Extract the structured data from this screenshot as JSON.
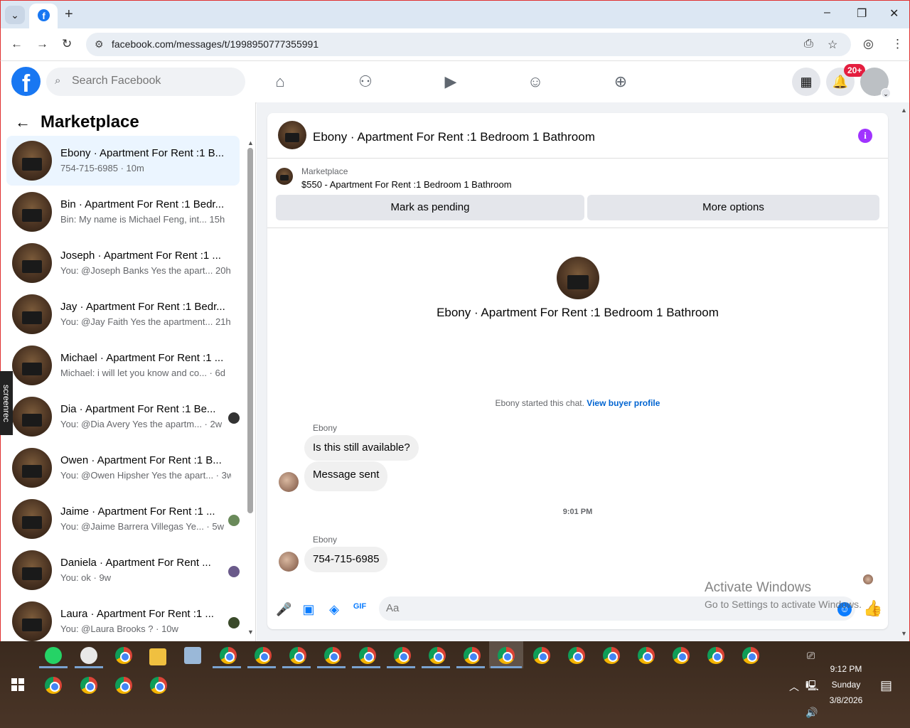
{
  "browser": {
    "tab_menu_icon": "chevron-down-icon",
    "new_tab": "+",
    "url": "facebook.com/messages/t/1998950777355991",
    "window_controls": [
      "–",
      "❐",
      "✕"
    ]
  },
  "fb": {
    "logo": "f",
    "search_placeholder": "Search Facebook",
    "notif_badge": "20+",
    "accent": "#1877f2"
  },
  "left": {
    "title": "Marketplace",
    "conversations": [
      {
        "name": "Ebony · Apartment For Rent :1 B...",
        "preview": "754-715-6985 · 10m"
      },
      {
        "name": "Bin · Apartment For Rent :1 Bedr...",
        "preview": "Bin: My name is Michael Feng, int... 15h"
      },
      {
        "name": "Joseph · Apartment For Rent :1 ...",
        "preview": "You: @Joseph Banks Yes the apart... 20h"
      },
      {
        "name": "Jay · Apartment For Rent :1 Bedr...",
        "preview": "You: @Jay Faith Yes the apartment... 21h"
      },
      {
        "name": "Michael · Apartment For Rent :1 ...",
        "preview": "Michael: i will let you know and co... · 6d"
      },
      {
        "name": "Dia · Apartment For Rent :1 Be...",
        "preview": "You: @Dia Avery Yes the apartm... · 2w"
      },
      {
        "name": "Owen · Apartment For Rent :1 B...",
        "preview": "You: @Owen Hipsher Yes the apart... · 3w"
      },
      {
        "name": "Jaime · Apartment For Rent :1 ...",
        "preview": "You: @Jaime Barrera Villegas Ye... · 5w"
      },
      {
        "name": "Daniela · Apartment For Rent ...",
        "preview": "You: ok · 9w"
      },
      {
        "name": "Laura · Apartment For Rent :1 ...",
        "preview": "You: @Laura Brooks ? · 10w"
      }
    ],
    "screenrec": "screenrec"
  },
  "chat": {
    "title": "Ebony · Apartment For Rent :1 Bedroom 1 Bathroom",
    "marketplace_label": "Marketplace",
    "listing": "$550 - Apartment For Rent :1 Bedroom 1 Bathroom",
    "mark_pending": "Mark as pending",
    "more_options": "More options",
    "intro_name": "Ebony · Apartment For Rent :1 Bedroom 1 Bathroom",
    "started_text": "Ebony started this chat.",
    "view_profile": "View buyer profile",
    "sender1": "Ebony",
    "msg1": "Is this still available?",
    "msg2": "Message sent",
    "timestamp": "9:01 PM",
    "sender2": "Ebony",
    "msg3": "754-715-6985",
    "composer_placeholder": "Aa"
  },
  "watermark": {
    "line1": "Activate Windows",
    "line2": "Go to Settings to activate Windows."
  },
  "clock": {
    "time": "9:12 PM",
    "day": "Sunday",
    "date": "3/8/2026"
  }
}
